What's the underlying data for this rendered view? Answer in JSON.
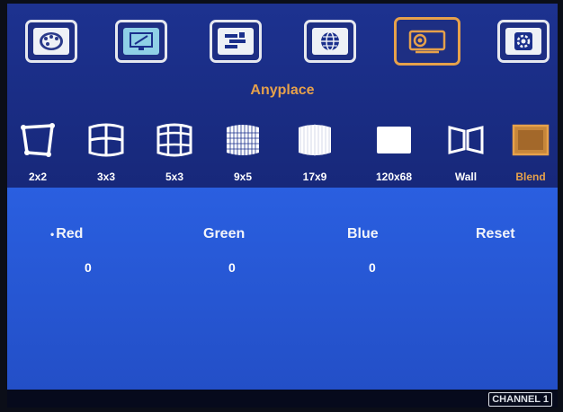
{
  "menu": {
    "categories": [
      {
        "name": "color-palette",
        "icon": "palette-icon"
      },
      {
        "name": "display-settings",
        "icon": "monitor-edit-icon"
      },
      {
        "name": "layout",
        "icon": "layout-bars-icon"
      },
      {
        "name": "network",
        "icon": "globe-icon"
      },
      {
        "name": "projector",
        "icon": "projector-icon",
        "selected": true
      },
      {
        "name": "system",
        "icon": "gear-icon"
      }
    ],
    "selected_title": "Anyplace"
  },
  "subitems": [
    {
      "label": "2x2",
      "icon": "warp-2x2-icon"
    },
    {
      "label": "3x3",
      "icon": "warp-3x3-icon"
    },
    {
      "label": "5x3",
      "icon": "warp-5x3-icon"
    },
    {
      "label": "9x5",
      "icon": "warp-9x5-icon"
    },
    {
      "label": "17x9",
      "icon": "warp-17x9-icon"
    },
    {
      "label": "120x68",
      "icon": "warp-120x68-icon"
    },
    {
      "label": "Wall",
      "icon": "wall-icon"
    },
    {
      "label": "Blend",
      "icon": "blend-icon",
      "selected": true
    }
  ],
  "blend": {
    "red": {
      "label": "Red",
      "value": "0"
    },
    "green": {
      "label": "Green",
      "value": "0"
    },
    "blue": {
      "label": "Blue",
      "value": "0"
    },
    "reset": {
      "label": "Reset"
    },
    "bullet": "•"
  },
  "status": {
    "channel": "CHANNEL 1"
  },
  "colors": {
    "accent": "#e6a14b",
    "panel": "#1a2f8c",
    "content": "#2a5fe0"
  }
}
